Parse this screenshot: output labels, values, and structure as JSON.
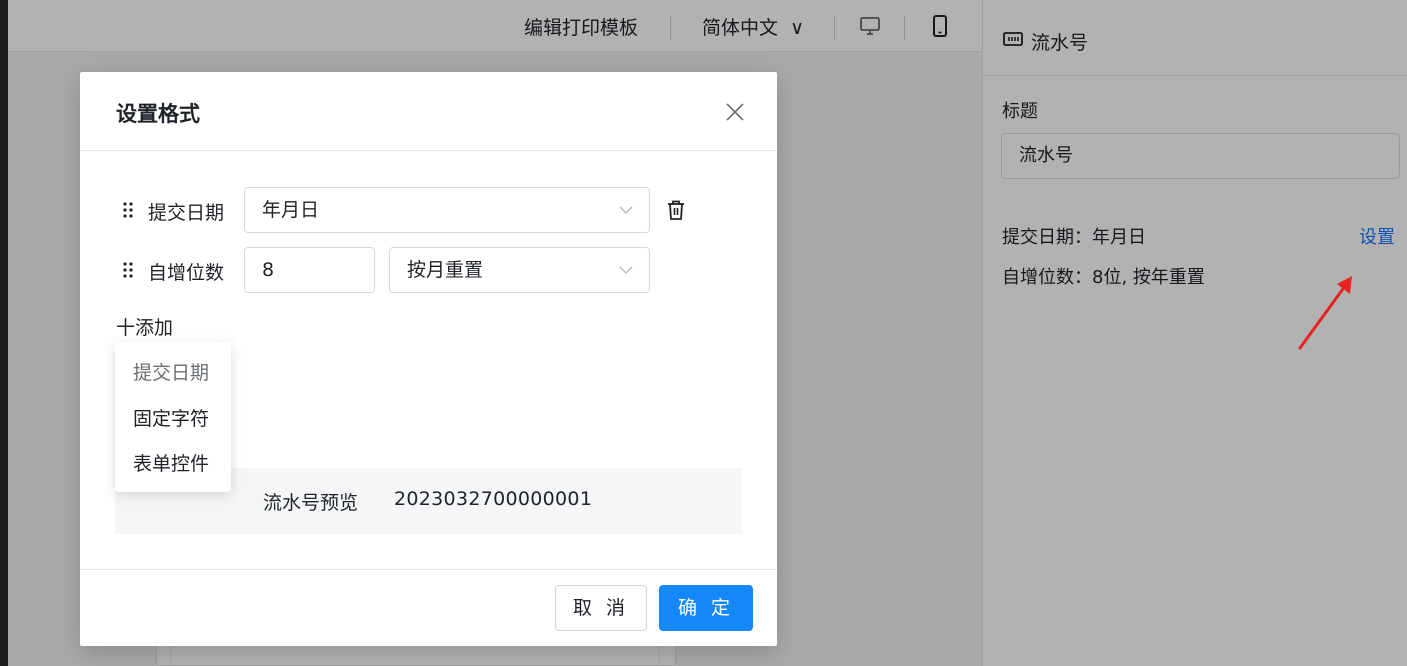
{
  "toolbar": {
    "edit_template": "编辑打印模板",
    "language": "简体中文",
    "language_chevron": "∨",
    "desktop_icon": "desktop-icon",
    "mobile_icon": "mobile-icon"
  },
  "right_panel": {
    "title": "流水号",
    "title_icon": "serial-number-icon",
    "label_title": "标题",
    "title_value": "流水号",
    "summary_date": "提交日期：年月日",
    "summary_seq": "自增位数：8位, 按年重置",
    "settings_link": "设置"
  },
  "modal": {
    "title": "设置格式",
    "rows": [
      {
        "label": "提交日期",
        "select_value": "年月日"
      },
      {
        "label": "自增位数",
        "number_value": "8",
        "select_value": "按月重置"
      }
    ],
    "add_label": "十添加",
    "dropdown_items": [
      {
        "label": "提交日期",
        "disabled": true
      },
      {
        "label": "固定字符",
        "disabled": false
      },
      {
        "label": "表单控件",
        "disabled": false
      }
    ],
    "preview_label": "流水号预览",
    "preview_value": "2023032700000001",
    "cancel_label": "取 消",
    "ok_label": "确 定"
  },
  "colors": {
    "primary": "#1487fb",
    "link": "#1677ff",
    "annotation_arrow": "#e8231f"
  }
}
